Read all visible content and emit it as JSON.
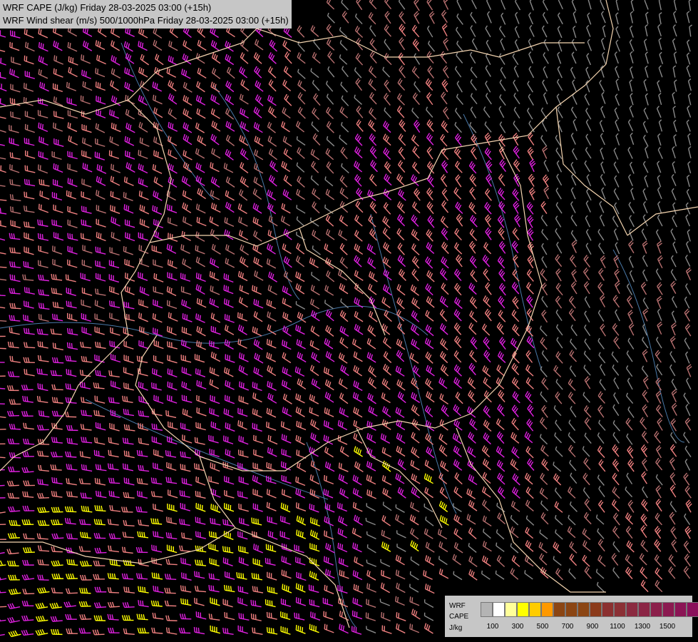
{
  "header": {
    "title_line1": "WRF CAPE (J/kg) Friday 28-03-2025 03:00 (+15h)",
    "title_line2": "WRF Wind shear (m/s) 500/1000hPa Friday 28-03-2025 03:00 (+15h)"
  },
  "legend": {
    "label_line1": "WRF",
    "label_line2": "CAPE",
    "label_line3": "J/kg",
    "swatch_colors": [
      "#b4b4b4",
      "#ffffff",
      "#ffff99",
      "#ffff00",
      "#ffcc00",
      "#ff9900",
      "#8b4513",
      "#8b4513",
      "#8b4513",
      "#8b3a1a",
      "#8b3030",
      "#8b3035",
      "#8b2a40",
      "#8b2545",
      "#8b1f4a",
      "#8b1a50",
      "#8b1555",
      "#8b105a",
      "#8b0a60",
      "#8b0565"
    ],
    "tick_labels": [
      "100",
      "300",
      "500",
      "700",
      "900",
      "1100",
      "1300",
      "1500"
    ]
  },
  "wind_shear_colors": {
    "weak": "#8a8a8a",
    "moderate": "#b87070",
    "strong": "#f08080",
    "very_strong": "#e020e0",
    "extreme": "#ffff00"
  },
  "map_colors": {
    "background": "#000000",
    "borders": "#f5d5b0",
    "rivers": "#4a7aaa"
  }
}
